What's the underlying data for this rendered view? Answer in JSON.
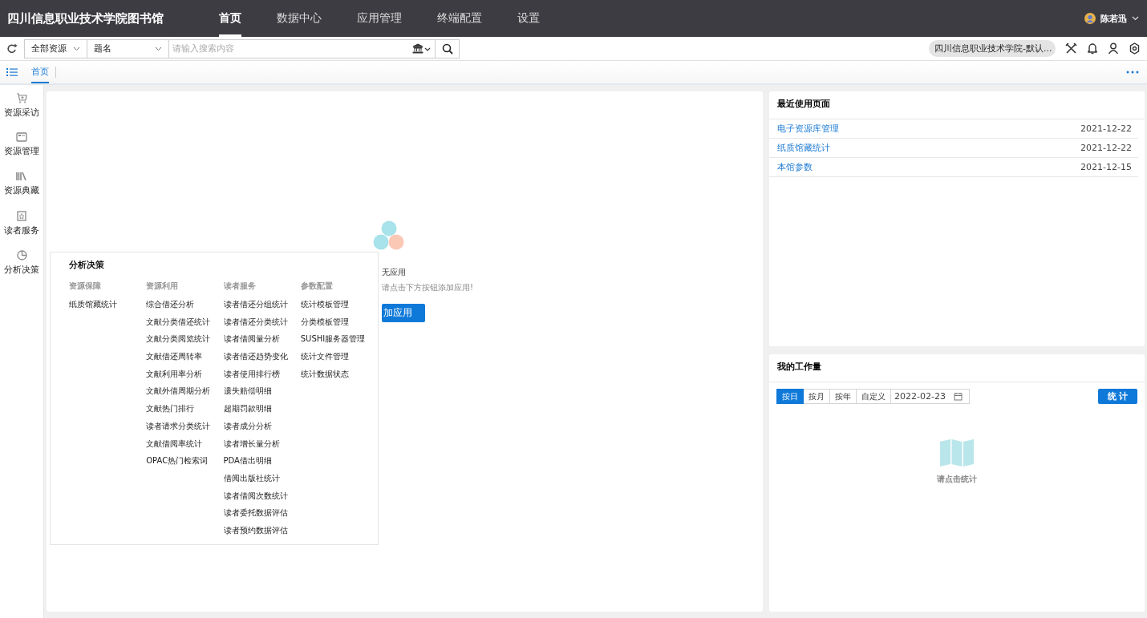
{
  "app_title": "四川信息职业技术学院图书馆",
  "nav": [
    {
      "label": "首页",
      "selected": true
    },
    {
      "label": "数据中心",
      "selected": false
    },
    {
      "label": "应用管理",
      "selected": false
    },
    {
      "label": "终端配置",
      "selected": false
    },
    {
      "label": "设置",
      "selected": false
    }
  ],
  "user": {
    "name": "陈若迅"
  },
  "search": {
    "scope": "全部资源",
    "field": "题名",
    "placeholder": "请输入搜索内容"
  },
  "library_select": {
    "value": "四川信息职业技术学院-默认..."
  },
  "tabs": [
    {
      "label": "首页",
      "selected": true
    }
  ],
  "sidebar": {
    "items": [
      {
        "label": "资源采访",
        "selected": false
      },
      {
        "label": "资源管理",
        "selected": false
      },
      {
        "label": "资源典藏",
        "selected": false
      },
      {
        "label": "读者服务",
        "selected": false
      },
      {
        "label": "分析决策",
        "selected": false
      }
    ]
  },
  "popup": {
    "title": "分析决策",
    "columns": [
      {
        "heading": "资源保障",
        "items": [
          "纸质馆藏统计"
        ]
      },
      {
        "heading": "资源利用",
        "items": [
          "综合借还分析",
          "文献分类借还统计",
          "文献分类阅览统计",
          "文献借还周转率",
          "文献利用率分析",
          "文献外借周期分析",
          "文献热门排行",
          "读者请求分类统计",
          "文献借阅率统计",
          "OPAC热门检索词"
        ]
      },
      {
        "heading": "读者服务",
        "items": [
          "读者借还分组统计",
          "读者借还分类统计",
          "读者借阅量分析",
          "读者借还趋势变化",
          "读者使用排行榜",
          "遗失赔偿明细",
          "超期罚款明细",
          "读者成分分析",
          "读者增长量分析",
          "PDA借出明细",
          "借阅出版社统计",
          "读者借阅次数统计",
          "读者委托数据评估",
          "读者预约数据评估"
        ]
      },
      {
        "heading": "参数配置",
        "items": [
          "统计模板管理",
          "分类模板管理",
          "SUSHI服务器管理",
          "统计文件管理",
          "统计数据状态"
        ]
      }
    ]
  },
  "apps_panel": {
    "empty_title": "无应用",
    "empty_hint": "请点击下方按钮添加应用!",
    "add_button": "加应用"
  },
  "recent": {
    "title": "最近使用页面",
    "rows": [
      {
        "page": "电子资源库管理",
        "date": "2021-12-22"
      },
      {
        "page": "纸质馆藏统计",
        "date": "2021-12-22"
      },
      {
        "page": "本馆参数",
        "date": "2021-12-15"
      }
    ]
  },
  "workload": {
    "title": "我的工作量",
    "periods": [
      {
        "label": "按日",
        "selected": true
      },
      {
        "label": "按月",
        "selected": false
      },
      {
        "label": "按年",
        "selected": false
      },
      {
        "label": "自定义",
        "selected": false
      }
    ],
    "date": "2022-02-23",
    "button": "统 计",
    "empty_hint": "请点击统计"
  }
}
